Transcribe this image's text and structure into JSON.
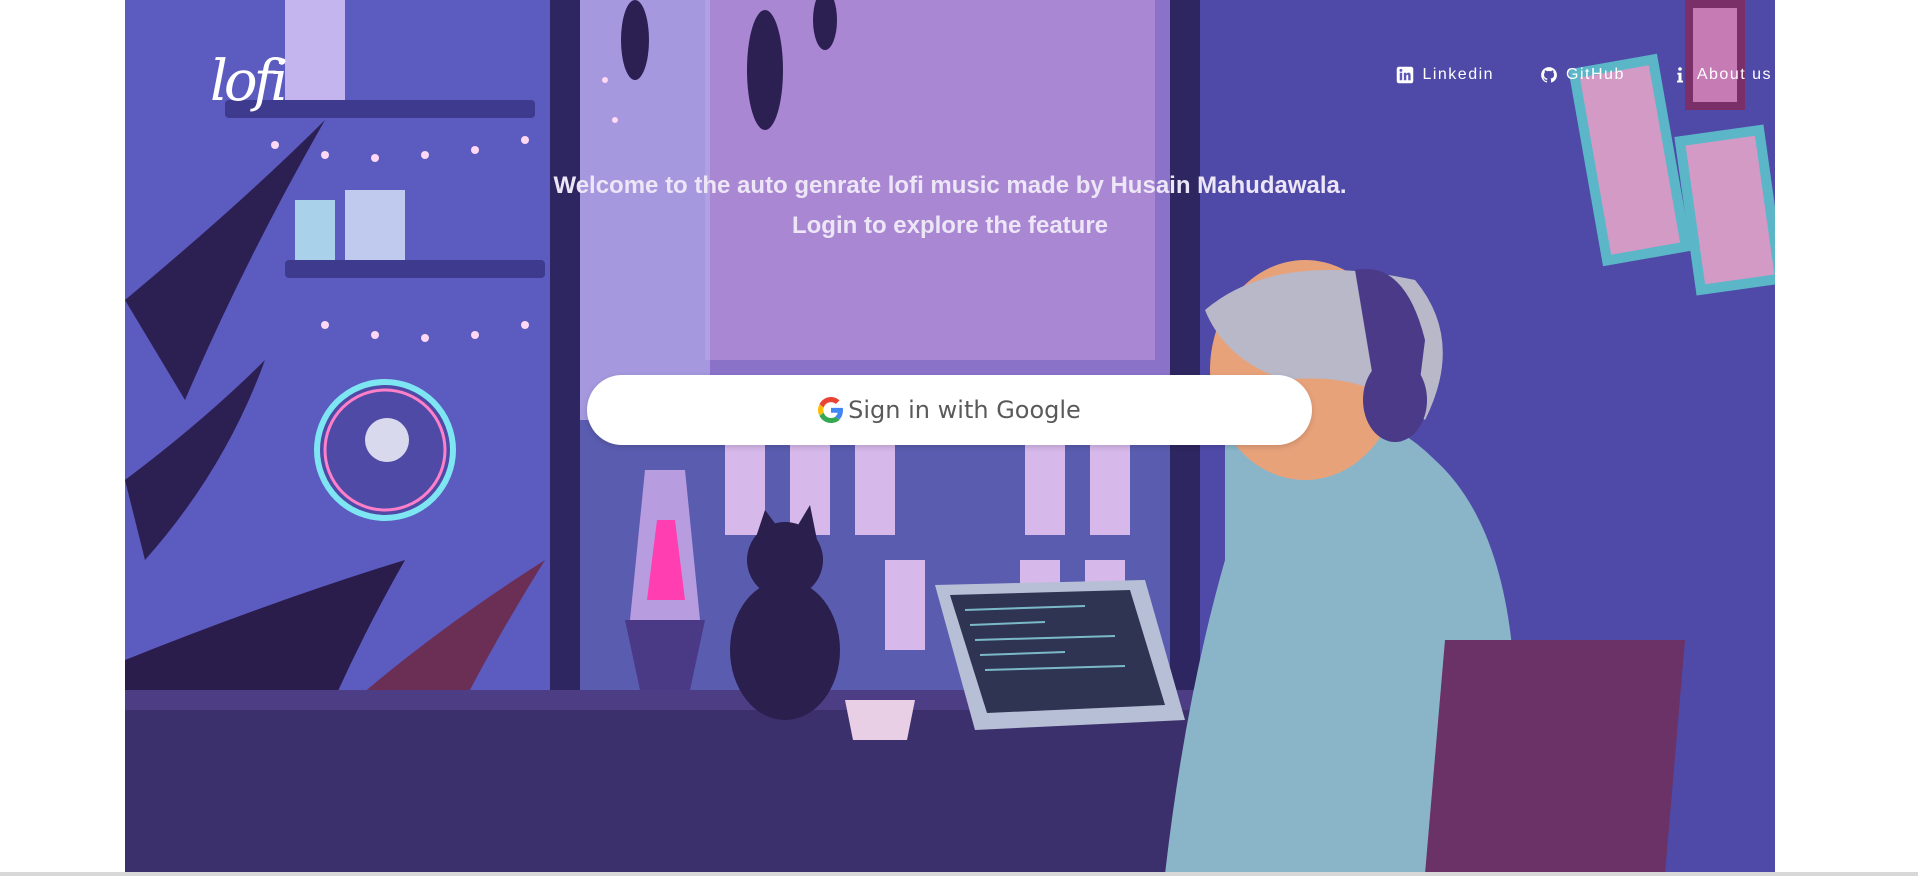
{
  "nav": {
    "items": [
      {
        "label": "Linkedin",
        "icon": "linkedin-icon"
      },
      {
        "label": "GitHub",
        "icon": "github-icon"
      },
      {
        "label": "About us",
        "icon": "info-icon"
      }
    ]
  },
  "logo": {
    "text": "lofi"
  },
  "welcome": {
    "line1": "Welcome to the auto genrate lofi music made by Husain Mahudawala.",
    "line2": "Login to explore the feature"
  },
  "signin": {
    "label": "Sign in with Google",
    "icon": "google-icon"
  },
  "colors": {
    "accent": "#5d57b9",
    "button_bg": "#ffffff",
    "button_text": "#5a5a5a"
  }
}
